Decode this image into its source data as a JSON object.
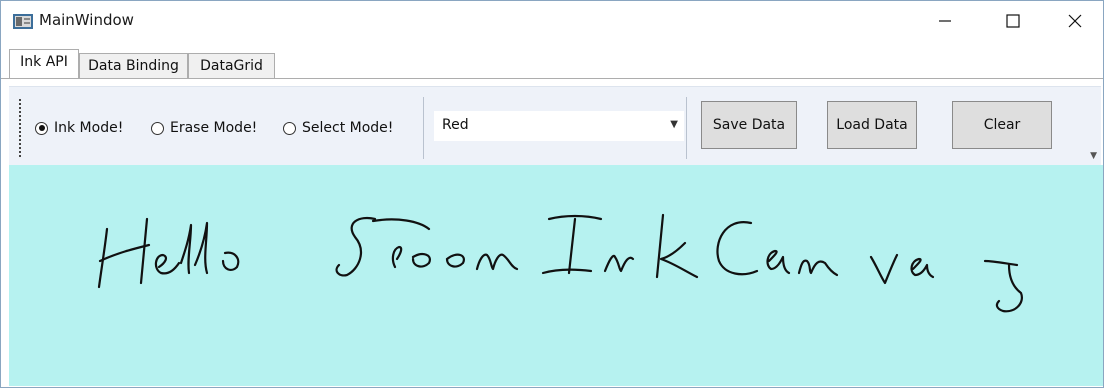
{
  "window": {
    "title": "MainWindow"
  },
  "tabs": [
    {
      "label": "Ink API",
      "active": true
    },
    {
      "label": "Data Binding",
      "active": false
    },
    {
      "label": "DataGrid",
      "active": false
    }
  ],
  "toolbar": {
    "modes": [
      {
        "label": "Ink Mode!",
        "checked": true
      },
      {
        "label": "Erase Mode!",
        "checked": false
      },
      {
        "label": "Select Mode!",
        "checked": false
      }
    ],
    "color_select": {
      "value": "Red"
    },
    "save_label": "Save Data",
    "load_label": "Load Data",
    "clear_label": "Clear"
  },
  "ink_canvas": {
    "background": "#b6f2f0"
  },
  "icons": {
    "app": "app-icon",
    "minimize": "minimize-icon",
    "maximize": "maximize-icon",
    "close": "close-icon",
    "dropdown": "chevron-down-icon",
    "overflow": "overflow-icon"
  }
}
